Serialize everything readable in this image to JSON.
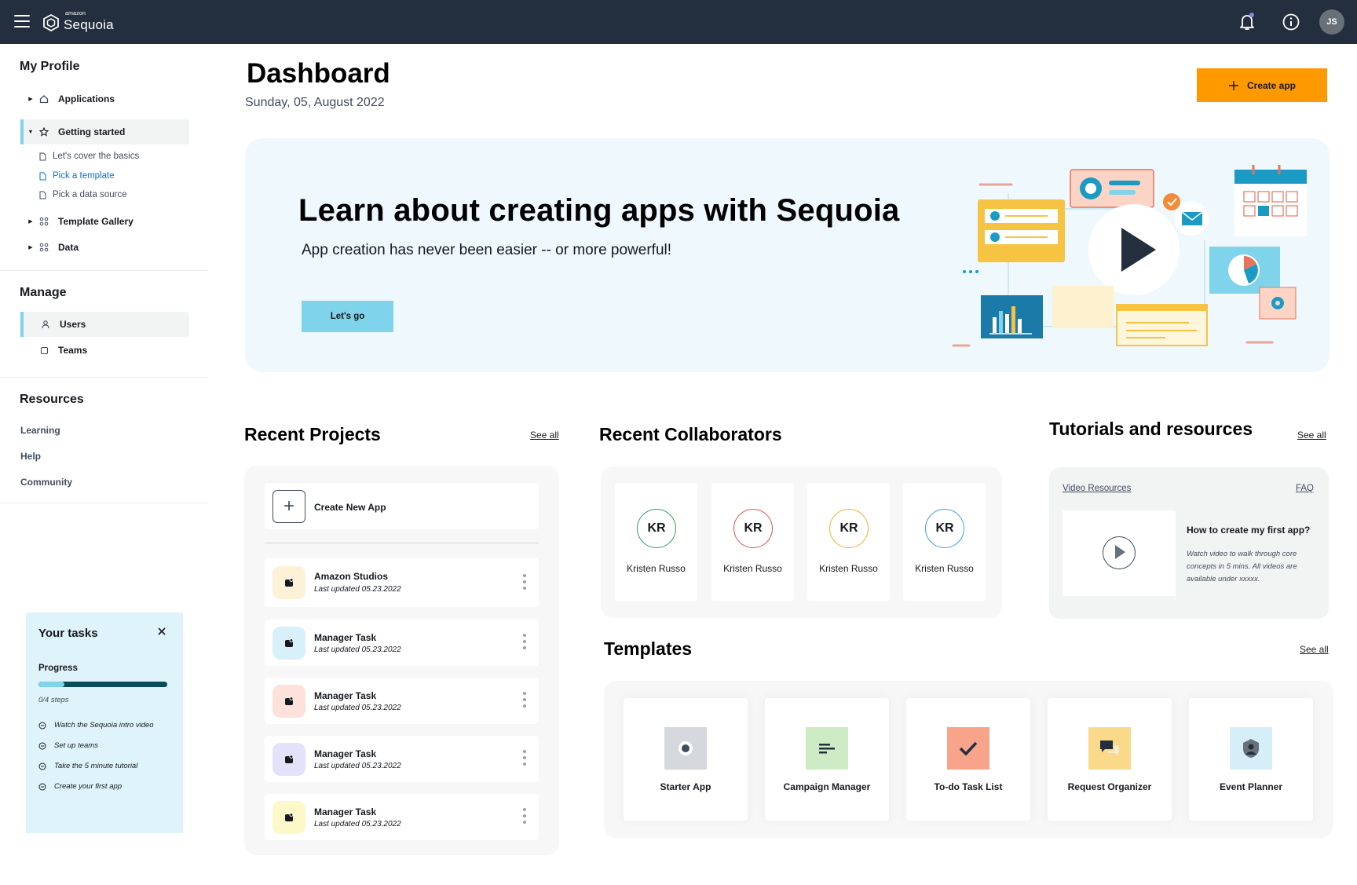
{
  "app": {
    "brand_small": "amazon",
    "brand_name": "Sequoia"
  },
  "header": {
    "user_initials": "JS"
  },
  "sidebar": {
    "profile_heading": "My Profile",
    "applications": "Applications",
    "getting_started": "Getting started",
    "getting_started_items": [
      "Let's cover the basics",
      "Pick a template",
      "Pick a data source"
    ],
    "template_gallery": "Template Gallery",
    "data": "Data",
    "manage_heading": "Manage",
    "users": "Users",
    "teams": "Teams",
    "resources_heading": "Resources",
    "resources": [
      "Learning",
      "Help",
      "Community"
    ]
  },
  "tasks": {
    "title": "Your tasks",
    "progress_label": "Progress",
    "progress_fraction": 0.2,
    "steps_text": "0/4 steps",
    "items": [
      "Watch the Sequoia intro video",
      "Set up teams",
      "Take the 5 minute tutorial",
      "Create your first app"
    ]
  },
  "page": {
    "title": "Dashboard",
    "date": "Sunday, 05, August 2022",
    "create_app": "Create app"
  },
  "hero": {
    "title": "Learn about creating apps with Sequoia",
    "subtitle": "App creation has never been easier -- or more powerful!",
    "button": "Let's go"
  },
  "recent_projects": {
    "title": "Recent Projects",
    "see_all": "See all",
    "create_new": "Create New App",
    "items": [
      {
        "name": "Amazon Studios",
        "meta": "Last updated 05.23.2022",
        "color": "#fdf1d8"
      },
      {
        "name": "Manager Task",
        "meta": "Last updated 05.23.2022",
        "color": "#d8f0f9"
      },
      {
        "name": "Manager Task",
        "meta": "Last updated 05.23.2022",
        "color": "#fde2dc"
      },
      {
        "name": "Manager Task",
        "meta": "Last updated 05.23.2022",
        "color": "#e4e2fb"
      },
      {
        "name": "Manager Task",
        "meta": "Last updated 05.23.2022",
        "color": "#fdf8c8"
      }
    ]
  },
  "collaborators": {
    "title": "Recent Collaborators",
    "items": [
      {
        "initials": "KR",
        "name": "Kristen Russo",
        "ring": "#2e9e5b"
      },
      {
        "initials": "KR",
        "name": "Kristen Russo",
        "ring": "#e05252"
      },
      {
        "initials": "KR",
        "name": "Kristen Russo",
        "ring": "#f2b12c"
      },
      {
        "initials": "KR",
        "name": "Kristen Russo",
        "ring": "#3aa0e0"
      }
    ]
  },
  "tutorials": {
    "title": "Tutorials and resources",
    "see_all": "See all",
    "video_resources": "Video Resources",
    "faq": "FAQ",
    "video_title": "How to create my first app?",
    "video_desc": "Watch video to walk through core concepts in 5 mins. All videos are available under xxxxx."
  },
  "templates": {
    "title": "Templates",
    "see_all": "See all",
    "items": [
      {
        "name": "Starter App",
        "icon": "record-icon",
        "color": "#d5d8dc"
      },
      {
        "name": "Campaign Manager",
        "icon": "text-lines-icon",
        "color": "#cdebc4"
      },
      {
        "name": "To-do Task List",
        "icon": "checkmark-icon",
        "color": "#f7a48a"
      },
      {
        "name": "Request Organizer",
        "icon": "chat-icon",
        "color": "#fbd98a"
      },
      {
        "name": "Event Planner",
        "icon": "person-shield-icon",
        "color": "#d6eef8"
      }
    ]
  }
}
